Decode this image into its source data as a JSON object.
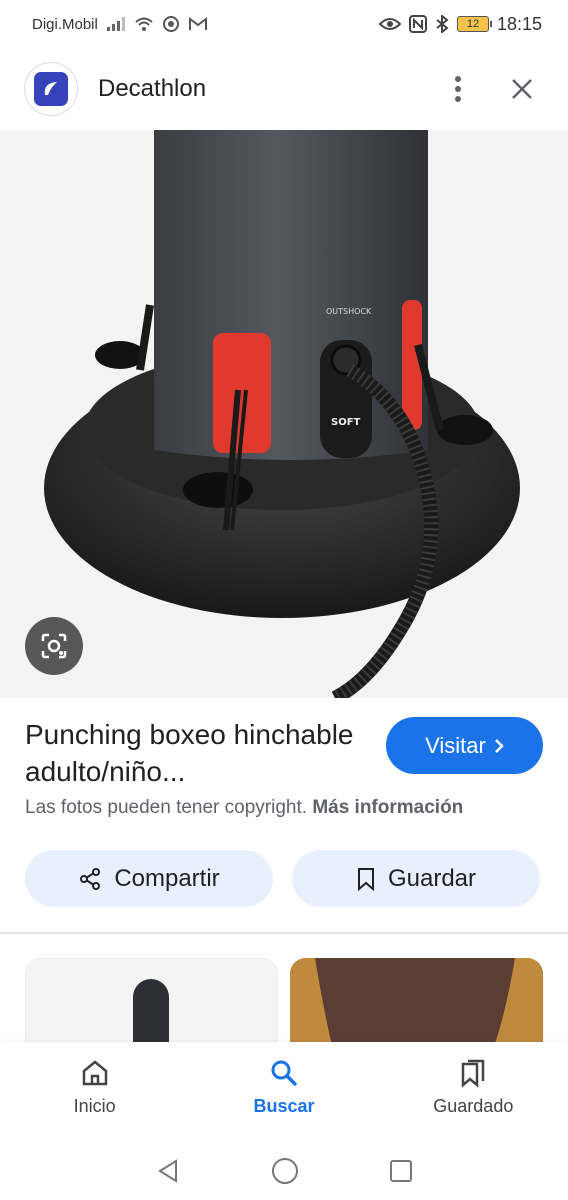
{
  "status_bar": {
    "carrier": "Digi.Mobil",
    "battery": "12",
    "time": "18:15"
  },
  "header": {
    "site_name": "Decathlon",
    "logo_icon": "decathlon-logo",
    "menu_icon": "more-vert-icon",
    "close_icon": "close-icon"
  },
  "hero": {
    "brand_print": "OUTSHOCK",
    "badge_print": "SOFT",
    "lens_icon": "google-lens-icon"
  },
  "result": {
    "title": "Punching boxeo hinchable adulto/niño...",
    "visit_label": "Visitar",
    "copyright_text": "Las fotos pueden tener copyright.",
    "more_info": "Más información",
    "share_label": "Compartir",
    "save_label": "Guardar"
  },
  "bottom_nav": {
    "items": [
      {
        "label": "Inicio",
        "icon": "home-icon"
      },
      {
        "label": "Buscar",
        "icon": "search-icon",
        "active": true
      },
      {
        "label": "Guardado",
        "icon": "bookmarks-icon"
      }
    ]
  },
  "colors": {
    "accent": "#1a73e8",
    "pill_bg": "#e8f0fe",
    "logo": "#3643ba"
  }
}
